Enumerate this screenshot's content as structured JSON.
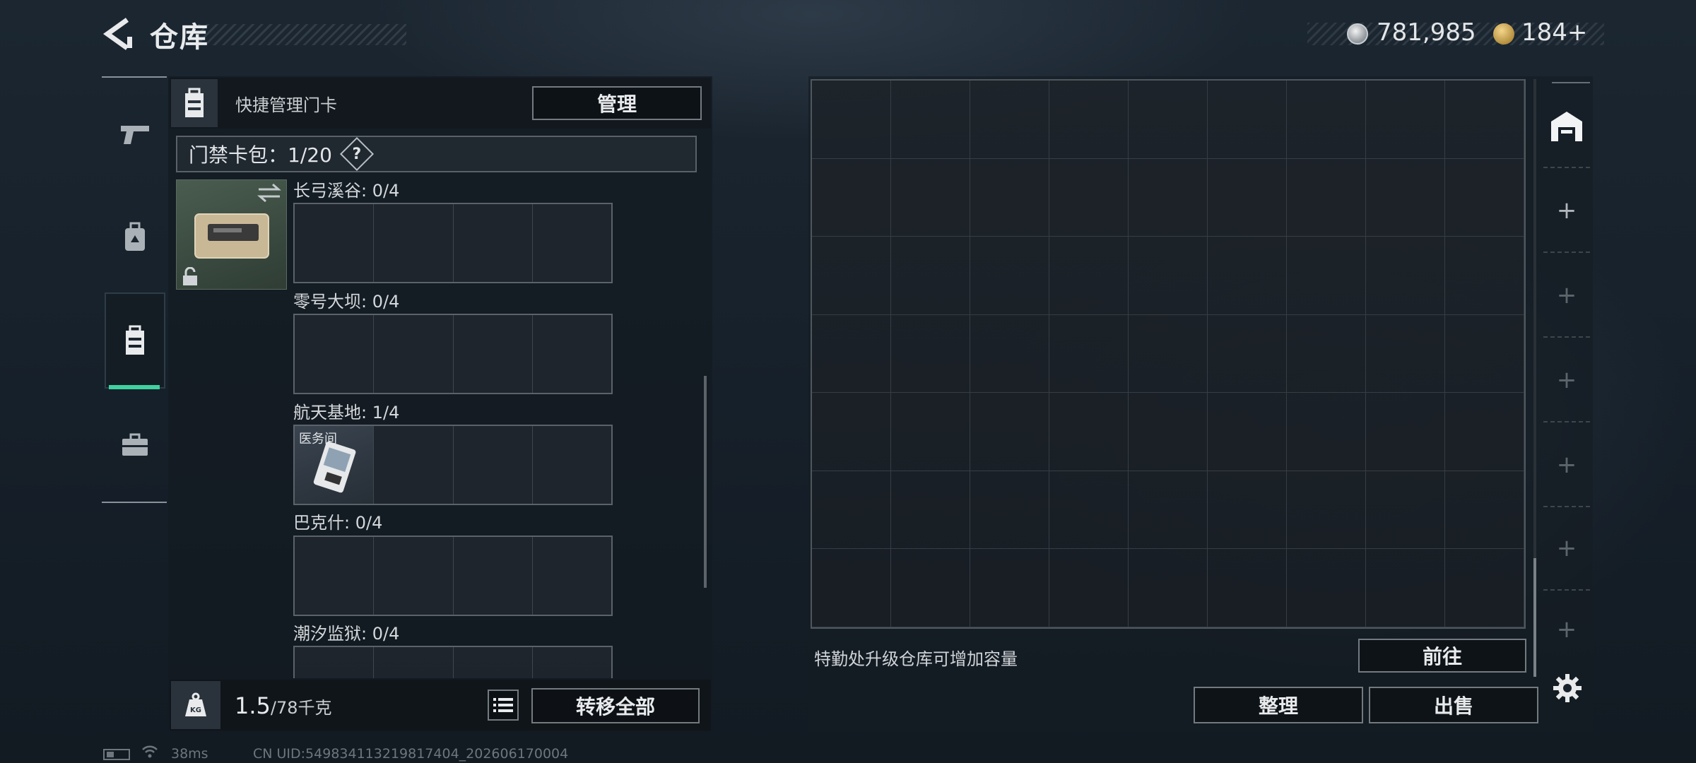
{
  "header": {
    "title": "仓库",
    "coins": "781,985",
    "tickets": "184",
    "tickets_plus": "+"
  },
  "left_nav": {
    "items": [
      {
        "id": "weapons",
        "icon": "gun-icon"
      },
      {
        "id": "gear",
        "icon": "backpack-icon"
      },
      {
        "id": "keycards",
        "icon": "keycard-case-icon",
        "active": true
      },
      {
        "id": "toolbox",
        "icon": "briefcase-icon"
      }
    ],
    "active_color": "#3fd1a0"
  },
  "keycard_panel": {
    "header_label": "快捷管理门卡",
    "manage_label": "管理",
    "cardpack_label": "门禁卡包：1/20",
    "help_mark": "?",
    "maps": [
      {
        "label": "长弓溪谷: 0/4",
        "items": []
      },
      {
        "label": "零号大坝: 0/4",
        "items": []
      },
      {
        "label": "航天基地: 1/4",
        "items": [
          {
            "slot": 0,
            "label": "医务间"
          }
        ]
      },
      {
        "label": "巴克什: 0/4",
        "items": []
      },
      {
        "label": "潮汐监狱: 0/4",
        "items": []
      }
    ],
    "weight_current": "1.5",
    "weight_total": "/78千克",
    "transfer_all_label": "转移全部"
  },
  "storage_panel": {
    "upgrade_hint": "特勤处升级仓库可增加容量",
    "goto_label": "前往",
    "tidy_label": "整理",
    "sell_label": "出售",
    "side_slots": [
      "+",
      "+",
      "+",
      "+",
      "+",
      "+"
    ]
  },
  "status_bar": {
    "ping": "38ms",
    "uid": "CN UID:549834113219817404_202606170004"
  }
}
